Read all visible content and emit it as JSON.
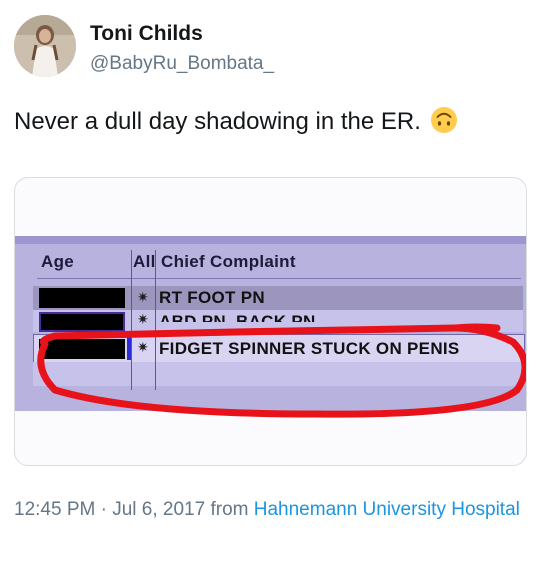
{
  "author": {
    "name": "Toni Childs",
    "handle": "@BabyRu_Bombata_",
    "avatar_icon": "profile-avatar"
  },
  "tweet": {
    "text": "Never a dull day shadowing in the ER.",
    "emoji_icon": "upside-down-face-icon"
  },
  "media": {
    "headers": {
      "age": "Age",
      "all": "All",
      "complaint": "Chief Complaint"
    },
    "rows": [
      {
        "complaint": "RT FOOT PN"
      },
      {
        "complaint": "ABD PN, BACK PN"
      },
      {
        "complaint": "FIDGET SPINNER STUCK ON PENIS"
      }
    ],
    "highlight_color": "#e8131a"
  },
  "footer": {
    "time": "12:45 PM",
    "separator": " · ",
    "date": "Jul 6, 2017",
    "from": " from ",
    "source": "Hahnemann University Hospital"
  }
}
